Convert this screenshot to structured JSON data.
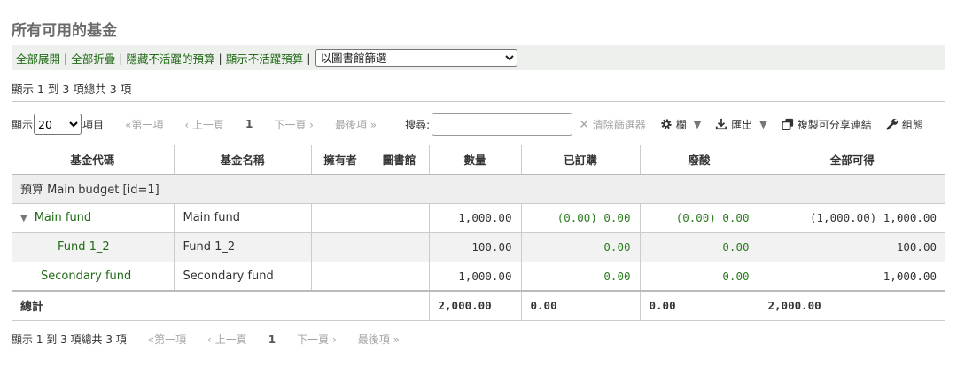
{
  "page": {
    "title": "所有可用的基金"
  },
  "toolbar": {
    "expand_all": "全部展開",
    "collapse_all": "全部折疊",
    "hide_inactive": "隱藏不活躍的預算",
    "show_inactive": "顯示不活躍預算",
    "sep": "|",
    "library_filter": "以圖書館篩選"
  },
  "info": {
    "top": "顯示 1 到 3 項總共 3 項",
    "bottom": "顯示 1 到 3 項總共 3 項"
  },
  "controls": {
    "show_prefix": "顯示",
    "page_length": "20",
    "items_suffix": "項目",
    "first": "«第一項",
    "prev": "‹ 上一頁",
    "current_page": "1",
    "next": "下一頁 ›",
    "last": "最後項 »",
    "search_label": "搜尋:",
    "search_value": "",
    "clear_filter": "清除篩選器",
    "columns": "欄",
    "export": "匯出",
    "copy_link": "複製可分享連結",
    "config": "組態"
  },
  "table": {
    "headers": [
      "基金代碼",
      "基金名稱",
      "擁有者",
      "圖書館",
      "數量",
      "已訂購",
      "廢酸",
      "全部可得"
    ],
    "budget_group": "預算 Main budget [id=1]",
    "rows": [
      {
        "code": "Main fund",
        "name": "Main fund",
        "owner": "",
        "library": "",
        "amount": "1,000.00",
        "ordered": "(0.00) 0.00",
        "spent": "(0.00) 0.00",
        "available": "(1,000.00) 1,000.00"
      },
      {
        "code": "Fund 1_2",
        "name": "Fund 1_2",
        "owner": "",
        "library": "",
        "amount": "100.00",
        "ordered": "0.00",
        "spent": "0.00",
        "available": "100.00"
      },
      {
        "code": "Secondary fund",
        "name": "Secondary fund",
        "owner": "",
        "library": "",
        "amount": "1,000.00",
        "ordered": "0.00",
        "spent": "0.00",
        "available": "1,000.00"
      }
    ],
    "total": {
      "label": "總計",
      "amount": "2,000.00",
      "ordered": "0.00",
      "spent": "0.00",
      "available": "2,000.00"
    }
  },
  "colors": {
    "link": "#216a16",
    "numeric_green": "#2b7d1e",
    "toolbar_bg": "#eef0ee"
  }
}
